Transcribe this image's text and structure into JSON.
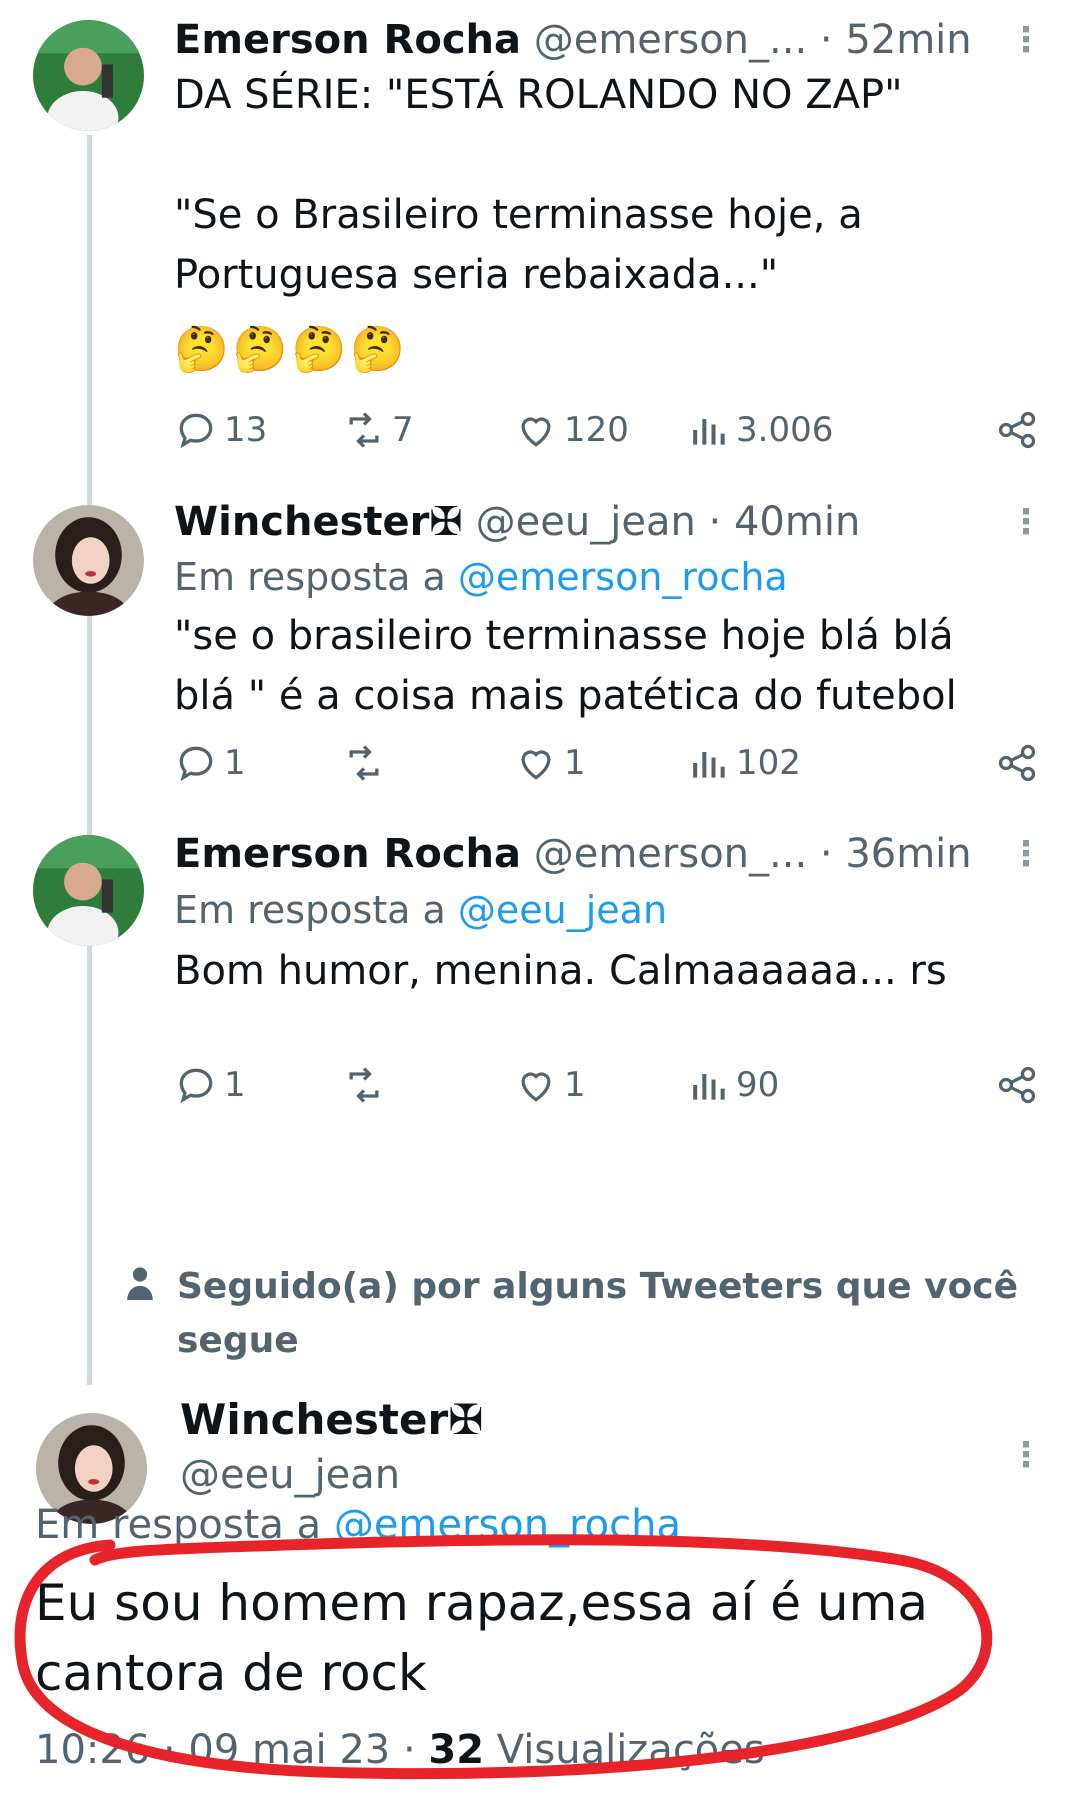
{
  "tweets": [
    {
      "name": "Emerson Rocha",
      "handle": "@emerson_...",
      "time": "· 52min",
      "text": "DA SÉRIE: \"ESTÁ ROLANDO NO ZAP\"\n\n\"Se o Brasileiro terminasse hoje, a\nPortuguesa seria rebaixada...\"",
      "emoji": "🤔🤔🤔🤔",
      "replies": "13",
      "retweets": "7",
      "likes": "120",
      "views": "3.006"
    },
    {
      "name": "Winchester✠",
      "handle": "@eeu_jean",
      "time": "· 40min",
      "replying_prefix": "Em resposta a ",
      "replying_to": "@emerson_rocha",
      "text": "\"se o brasileiro terminasse hoje blá blá\nblá \" é a coisa mais patética do futebol",
      "replies": "1",
      "retweets": "",
      "likes": "1",
      "views": "102"
    },
    {
      "name": "Emerson Rocha",
      "handle": "@emerson_...",
      "time": "· 36min",
      "replying_prefix": "Em resposta a ",
      "replying_to": "@eeu_jean",
      "text": "Bom humor, menina. Calmaaaaaa... rs",
      "replies": "1",
      "retweets": "",
      "likes": "1",
      "views": "90"
    }
  ],
  "followed_note": "Seguido(a) por alguns Tweeters que você segue",
  "focal": {
    "name": "Winchester✠",
    "handle": "@eeu_jean",
    "replying_prefix": "Em resposta a ",
    "replying_to": "@emerson_rocha",
    "text": "Eu sou homem rapaz,essa aí é uma\ncantora de rock",
    "time": "10:26 · 09 mai 23 · ",
    "views_count": "32",
    "views_label": " Visualizações"
  },
  "colors": {
    "mention": "#1d9bf0",
    "secondary": "#536471",
    "annotation": "#e8242b"
  },
  "icons": [
    "reply-icon",
    "retweet-icon",
    "like-icon",
    "views-icon",
    "share-icon",
    "more-icon",
    "person-icon"
  ]
}
